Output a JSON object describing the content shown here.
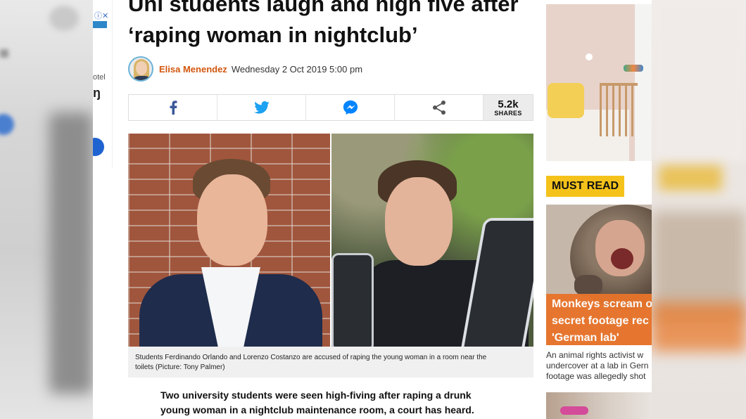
{
  "article": {
    "headline_line1": "Uni students laugh and high five after",
    "headline_line2": "‘raping woman in nightclub’",
    "author": "Elisa Menendez",
    "date": "Wednesday 2 Oct 2019 5:00 pm",
    "caption_line1": "Students Ferdinando Orlando and Lorenzo Costanzo are accused of raping the young woman in a room near the",
    "caption_line2": "toilets (Picture: Tony Palmer)",
    "lead_line1": "Two university students were seen high-fiving after raping a drunk",
    "lead_line2": "young woman in a nightclub maintenance room, a court has heard."
  },
  "share": {
    "buttons": [
      {
        "icon": "facebook-icon",
        "color": "#3b5998"
      },
      {
        "icon": "twitter-icon",
        "color": "#1da1f2"
      },
      {
        "icon": "messenger-icon",
        "color": "#0084ff"
      },
      {
        "icon": "share-icon",
        "color": "#555555"
      }
    ],
    "count": "5.2k",
    "count_label": "SHARES"
  },
  "sidebar": {
    "must_read_label": "MUST READ",
    "story_title_line1": "Monkeys scream o",
    "story_title_line2": "secret footage rec",
    "story_title_line3": "'German lab'",
    "story_teaser_line1": "An animal rights activist w",
    "story_teaser_line2": "undercover at a lab in Gern",
    "story_teaser_line3": "footage was allegedly shot"
  },
  "ad": {
    "close_label": "ⓘ✕",
    "text_fragment": "otel",
    "big_fragment": "ŋ"
  },
  "colors": {
    "author": "#d2570f",
    "must_read_bg": "#f4c21a",
    "story_overlay": "#e8742a"
  }
}
